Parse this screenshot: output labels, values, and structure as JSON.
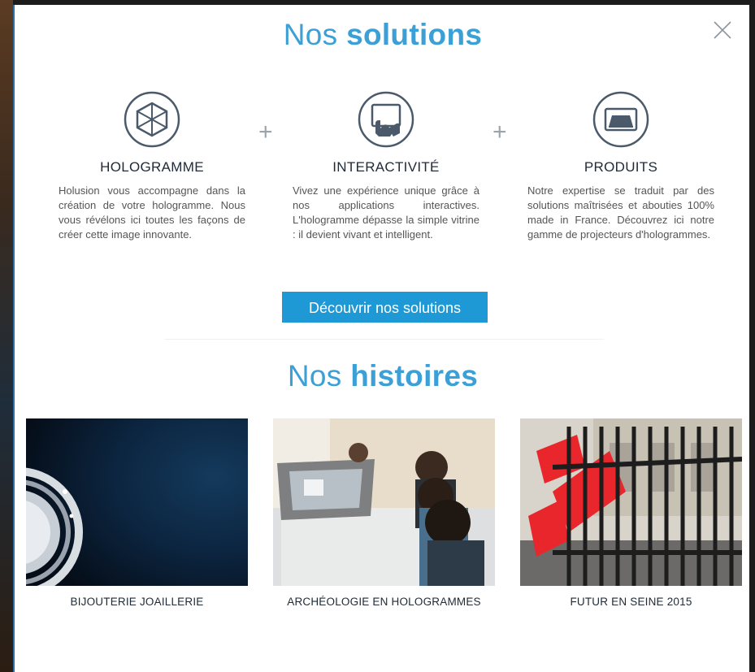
{
  "modal": {
    "solutions_title": {
      "prefix": "Nos",
      "bold": "solutions"
    },
    "histoires_title": {
      "prefix": "Nos",
      "bold": "histoires"
    },
    "close_icon": "close-icon"
  },
  "solutions": [
    {
      "icon": "cube-icon",
      "title": "HOLOGRAMME",
      "text": "Holusion vous accompagne dans la création de votre hologramme. Nous vous révélons ici toutes les façons de créer cette image innovante."
    },
    {
      "icon": "touch-screen-icon",
      "title": "INTERACTIVITÉ",
      "text": "Vivez une expérience unique grâce à nos applications interactives. L'hologramme dépasse la simple vitrine : il devient vivant et intelligent."
    },
    {
      "icon": "projector-icon",
      "title": "PRODUITS",
      "text": "Notre expertise se traduit par des solutions maîtrisées et abouties 100% made in France. Découvrez ici notre gamme de projecteurs d'hologrammes."
    }
  ],
  "plus_symbol": "+",
  "cta_label": "Découvrir nos solutions",
  "stories": [
    {
      "caption": "BIJOUTERIE JOAILLERIE"
    },
    {
      "caption": "ARCHÉOLOGIE EN HOLOGRAMMES"
    },
    {
      "caption": "FUTUR EN SEINE 2015"
    }
  ],
  "colors": {
    "accent": "#3ca0d6",
    "button": "#1f98d6",
    "heading": "#1f2a36",
    "icon_stroke": "#4a5a6a"
  }
}
